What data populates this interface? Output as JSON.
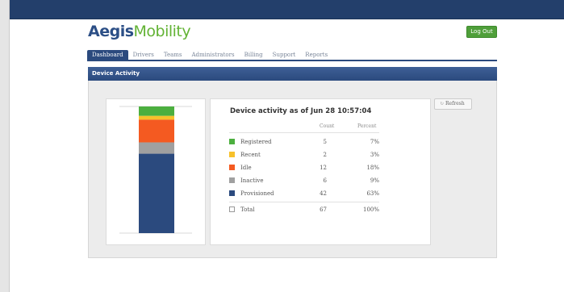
{
  "brand": {
    "name_bold": "Aegis",
    "name_light": "Mobility",
    "primary": "#2c4f86",
    "accent": "#63b335"
  },
  "header": {
    "logout_label": "Log Out"
  },
  "nav": {
    "tabs": [
      {
        "label": "Dashboard",
        "active": true
      },
      {
        "label": "Drivers",
        "active": false
      },
      {
        "label": "Teams",
        "active": false
      },
      {
        "label": "Administrators",
        "active": false
      },
      {
        "label": "Billing",
        "active": false
      },
      {
        "label": "Support",
        "active": false
      },
      {
        "label": "Reports",
        "active": false
      }
    ]
  },
  "panel": {
    "title": "Device Activity"
  },
  "stats": {
    "title": "Device activity as of Jun 28 10:57:04",
    "count_header": "Count",
    "percent_header": "Percent",
    "rows": [
      {
        "label": "Registered",
        "count": "5",
        "percent": "7%",
        "color": "#4caf3f"
      },
      {
        "label": "Recent",
        "count": "2",
        "percent": "3%",
        "color": "#f7c12b"
      },
      {
        "label": "Idle",
        "count": "12",
        "percent": "18%",
        "color": "#f45a21"
      },
      {
        "label": "Inactive",
        "count": "6",
        "percent": "9%",
        "color": "#a0a0a0"
      },
      {
        "label": "Provisioned",
        "count": "42",
        "percent": "63%",
        "color": "#2b4a7e"
      }
    ],
    "total": {
      "label": "Total",
      "count": "67",
      "percent": "100%"
    }
  },
  "refresh": {
    "label": "Refresh",
    "icon": "refresh-icon"
  },
  "chart_data": {
    "type": "bar",
    "stacked": true,
    "categories": [
      ""
    ],
    "series": [
      {
        "name": "Registered",
        "values": [
          5
        ],
        "color": "#4caf3f"
      },
      {
        "name": "Recent",
        "values": [
          2
        ],
        "color": "#f7c12b"
      },
      {
        "name": "Idle",
        "values": [
          12
        ],
        "color": "#f45a21"
      },
      {
        "name": "Inactive",
        "values": [
          6
        ],
        "color": "#a0a0a0"
      },
      {
        "name": "Provisioned",
        "values": [
          42
        ],
        "color": "#2b4a7e"
      }
    ],
    "ylim": [
      0,
      67
    ],
    "grid": false,
    "legend": "none"
  }
}
